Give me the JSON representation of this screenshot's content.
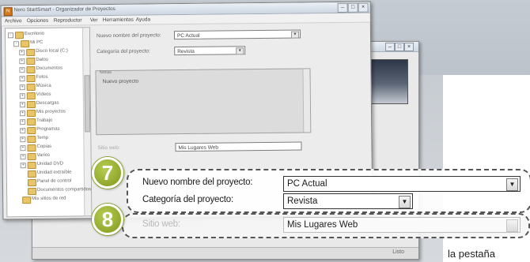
{
  "front_window": {
    "title": "Nero StartSmart - Organizador de Proyectos",
    "menu": [
      "Archivo",
      "Opciones",
      "Reproductor",
      "Ver",
      "Herramientas",
      "Ayuda"
    ],
    "tree": [
      {
        "label": "Escritorio",
        "level": 0,
        "expander": "-"
      },
      {
        "label": "Mi PC",
        "level": 1,
        "expander": "-"
      },
      {
        "label": "Disco local (C:)",
        "level": 2,
        "expander": "+"
      },
      {
        "label": "Datos",
        "level": 2,
        "expander": "+"
      },
      {
        "label": "Documentos",
        "level": 2,
        "expander": "+"
      },
      {
        "label": "Fotos",
        "level": 2,
        "expander": "+"
      },
      {
        "label": "Música",
        "level": 2,
        "expander": "+"
      },
      {
        "label": "Vídeos",
        "level": 2,
        "expander": "+"
      },
      {
        "label": "Descargas",
        "level": 2,
        "expander": "+"
      },
      {
        "label": "Mis proyectos",
        "level": 2,
        "expander": "+"
      },
      {
        "label": "Trabajo",
        "level": 2,
        "expander": "+"
      },
      {
        "label": "Programas",
        "level": 2,
        "expander": "+"
      },
      {
        "label": "Temp",
        "level": 2,
        "expander": "+"
      },
      {
        "label": "Copias",
        "level": 2,
        "expander": "+"
      },
      {
        "label": "Varios",
        "level": 2,
        "expander": "+"
      },
      {
        "label": "Unidad DVD",
        "level": 2,
        "expander": "+"
      },
      {
        "label": "Unidad extraíble",
        "level": 2,
        "expander": ""
      },
      {
        "label": "Panel de control",
        "level": 2,
        "expander": ""
      },
      {
        "label": "Documentos compartidos",
        "level": 2,
        "expander": ""
      },
      {
        "label": "Mis sitios de red",
        "level": 1,
        "expander": ""
      }
    ],
    "form": {
      "name_label": "Nuevo nombre del proyecto:",
      "name_value": "PC Actual",
      "category_label": "Categoría del proyecto:",
      "category_value": "Revista",
      "group_title": "Notas",
      "group_text": "Nuevo proyecto",
      "url_label": "Sitio web:",
      "url_value": "Mis Lugares Web"
    }
  },
  "back_window": {
    "status_text": "Listo"
  },
  "callouts": {
    "step7": {
      "number": "7",
      "name_label": "Nuevo nombre del proyecto:",
      "name_value": "PC Actual",
      "dropdown_glyph": "▼",
      "category_label": "Categoría del proyecto:",
      "category_value": "Revista"
    },
    "step8": {
      "number": "8",
      "url_label": "Sitio web:",
      "url_value": "Mis Lugares Web"
    }
  },
  "caption": "la pestaña",
  "colors": {
    "badge_green": "#8ea52a",
    "background_gray": "#c4cbd2"
  }
}
